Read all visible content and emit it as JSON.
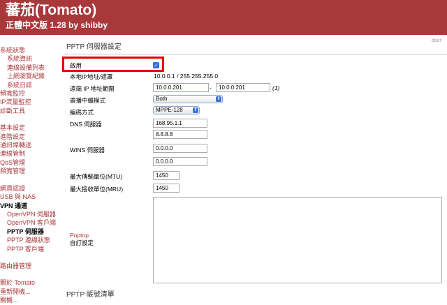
{
  "header": {
    "title": "蕃茄(Tomato)",
    "subtitle": "正體中文版 1.28 by shibby"
  },
  "door": "door",
  "sidebar": {
    "items": [
      {
        "label": "系統狀態",
        "sub": false
      },
      {
        "label": "系統資訊",
        "sub": true
      },
      {
        "label": "連線設備列表",
        "sub": true
      },
      {
        "label": "上網瀏覽紀錄",
        "sub": true
      },
      {
        "label": "系統日誌",
        "sub": true
      },
      {
        "label": "頻寬監控",
        "sub": false
      },
      {
        "label": "IP流量監控",
        "sub": false
      },
      {
        "label": "診斷工具",
        "sub": false
      },
      {
        "label": "",
        "gap": true
      },
      {
        "label": "基本設定",
        "sub": false
      },
      {
        "label": "進階設定",
        "sub": false
      },
      {
        "label": "通訊埠轉送",
        "sub": false
      },
      {
        "label": "連線管制",
        "sub": false
      },
      {
        "label": "QoS管理",
        "sub": false
      },
      {
        "label": "頻寬管理",
        "sub": false
      },
      {
        "label": "",
        "gap": true
      },
      {
        "label": "網頁認證",
        "sub": false
      },
      {
        "label": "USB 與 NAS",
        "sub": false
      },
      {
        "label": "VPN 通道",
        "sub": false,
        "active": true
      },
      {
        "label": "OpenVPN 伺服器",
        "sub": true
      },
      {
        "label": "OpenVPN 客戶端",
        "sub": true
      },
      {
        "label": "PPTP 伺服器",
        "sub": true,
        "active": true
      },
      {
        "label": "PPTP 連線狀態",
        "sub": true
      },
      {
        "label": "PPTP 客戶端",
        "sub": true
      },
      {
        "label": "",
        "gap": true
      },
      {
        "label": "路由器管理",
        "sub": false
      },
      {
        "label": "",
        "gap": true
      },
      {
        "label": "關於 Tomato",
        "sub": false
      },
      {
        "label": "重新開機...",
        "sub": false
      },
      {
        "label": "關機...",
        "sub": false
      }
    ]
  },
  "section_title": "PPTP 伺服器設定",
  "section2_title": "PPTP 帳號清單",
  "form": {
    "enable_label": "啟用",
    "enable_checked": true,
    "local_ip_label": "本地IP地址/遮罩",
    "local_ip_value": "10.0.0.1 / 255.255.255.0",
    "remote_range_label": "遠端 IP 地址範圍",
    "remote_start": "10.0.0.201",
    "remote_sep": "-",
    "remote_end": "10.0.0.201",
    "remote_note": "(1)",
    "broadcast_label": "廣播中繼模式",
    "broadcast_value": "Both",
    "encryption_label": "編碼方式",
    "encryption_value": "MPPE-128",
    "dns_label": "DNS 伺服器",
    "dns1": "168.95.1.1",
    "dns2": "8.8.8.8",
    "wins_label": "WINS 伺服器",
    "wins1": "0.0.0.0",
    "wins2": "0.0.0.0",
    "mtu_label": "最大傳輸單位(MTU)",
    "mtu_value": "1450",
    "mru_label": "最大接收單位(MRU)",
    "mru_value": "1450",
    "custom_label_1": "Poptop",
    "custom_label_2": "自訂設定"
  }
}
